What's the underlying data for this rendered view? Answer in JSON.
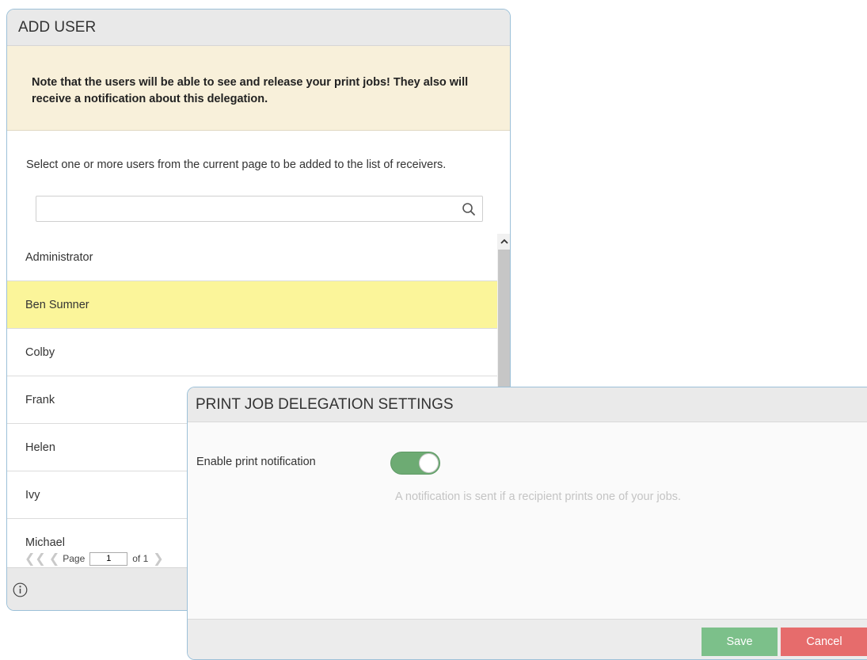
{
  "add_user": {
    "title": "ADD USER",
    "note": "Note that the users will be able to see and release your print jobs! They also will receive a notification about this delegation.",
    "instruction": "Select one or more users from the current page to be added to the list of receivers.",
    "search": {
      "value": "",
      "placeholder": ""
    },
    "users": [
      {
        "name": "Administrator",
        "selected": false
      },
      {
        "name": "Ben Sumner",
        "selected": true
      },
      {
        "name": "Colby",
        "selected": false
      },
      {
        "name": "Frank",
        "selected": false
      },
      {
        "name": "Helen",
        "selected": false
      },
      {
        "name": "Ivy",
        "selected": false
      },
      {
        "name": "Michael",
        "selected": false
      }
    ],
    "pager": {
      "label": "Page",
      "current": "1",
      "of_label": "of 1"
    }
  },
  "settings": {
    "title": "PRINT JOB DELEGATION SETTINGS",
    "enable_label": "Enable print notification",
    "enabled": true,
    "help_text": "A notification is sent if a recipient prints one of your jobs.",
    "save_label": "Save",
    "cancel_label": "Cancel"
  },
  "colors": {
    "selected_row": "#fbf59a",
    "note_bg": "#f8f0da",
    "toggle_on": "#6dab73",
    "save": "#7cc08a",
    "cancel": "#e66c6c",
    "dialog_border": "#9cc0d8"
  },
  "icons": {
    "search": "search-icon",
    "info": "info-icon",
    "first_page": "double-chevron-left-icon",
    "prev_page": "chevron-left-icon",
    "next_page": "chevron-right-icon",
    "scroll_up": "chevron-up-icon"
  }
}
